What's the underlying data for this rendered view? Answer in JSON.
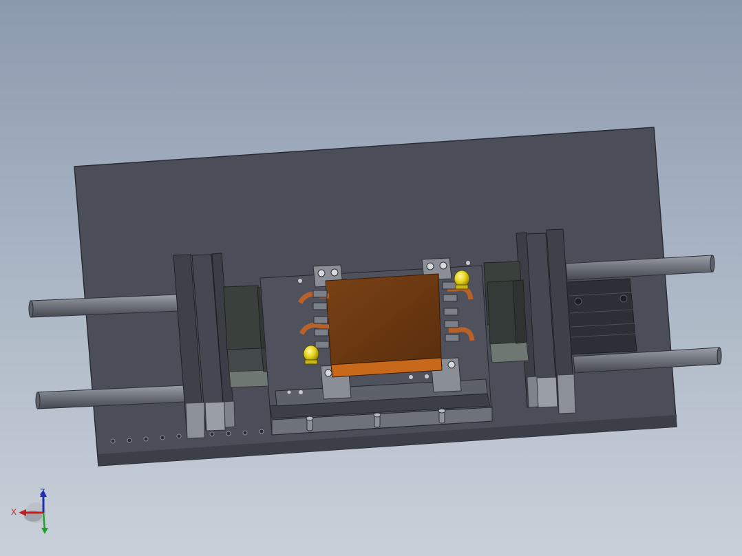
{
  "scene": {
    "background_top": "#8c9aae",
    "background_bottom": "#c9d0d9",
    "baseplate_color": "#4b4e58",
    "steel_color": "#656a75",
    "rod_color": "#6f747e",
    "copper_color": "#6e3a12",
    "copper_edge_color": "#c7681a",
    "brass_color": "#e5d21a"
  },
  "triad": {
    "x_label": "X",
    "z_label": "Z",
    "x_color": "#c02020",
    "z_color": "#1e2fb5",
    "y_color": "#1fa02a"
  }
}
